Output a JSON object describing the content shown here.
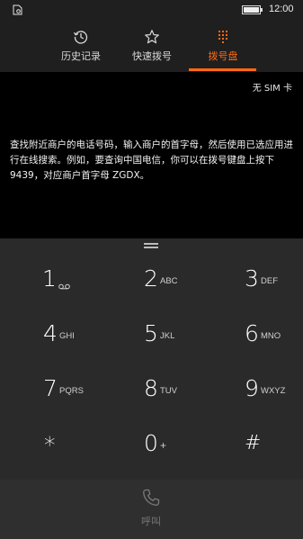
{
  "status_bar": {
    "time": "12:00",
    "left_icon": "settings-sim-icon",
    "battery": "battery-full-icon"
  },
  "tabs": [
    {
      "label": "历史记录",
      "icon": "history-icon",
      "active": false
    },
    {
      "label": "快速拨号",
      "icon": "star-icon",
      "active": false
    },
    {
      "label": "拨号盘",
      "icon": "dialpad-icon",
      "active": true
    }
  ],
  "message": {
    "sim_status": "无 SIM 卡",
    "hint": "查找附近商户的电话号码，输入商户的首字母，然后使用已选应用进行在线搜索。例如，要查询中国电信，你可以在拨号键盘上按下 9439，对应商户首字母 ZGDX。"
  },
  "keypad": [
    {
      "digit": "1",
      "letters": "",
      "sub_icon": "voicemail-icon"
    },
    {
      "digit": "2",
      "letters": "ABC"
    },
    {
      "digit": "3",
      "letters": "DEF"
    },
    {
      "digit": "4",
      "letters": "GHI"
    },
    {
      "digit": "5",
      "letters": "JKL"
    },
    {
      "digit": "6",
      "letters": "MNO"
    },
    {
      "digit": "7",
      "letters": "PQRS"
    },
    {
      "digit": "8",
      "letters": "TUV"
    },
    {
      "digit": "9",
      "letters": "WXYZ"
    },
    {
      "digit": "*",
      "letters": ""
    },
    {
      "digit": "0",
      "letters": "+"
    },
    {
      "digit": "#",
      "letters": ""
    }
  ],
  "call": {
    "label": "呼叫",
    "icon": "phone-icon"
  },
  "colors": {
    "accent": "#ff6a13",
    "background": "#000000",
    "panel": "#2a2a2a",
    "call_bar": "#2f2f2f"
  }
}
